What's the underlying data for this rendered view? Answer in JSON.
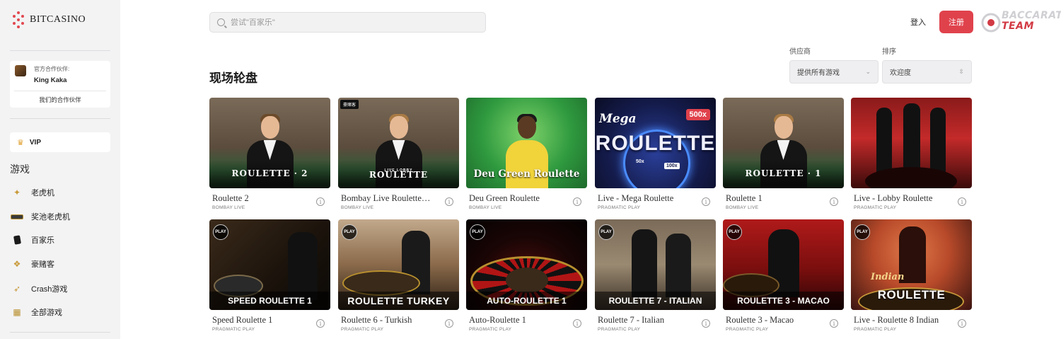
{
  "sidebar": {
    "logo_text": "BITCASINO",
    "partner": {
      "label": "官方合作伙伴:",
      "name": "King Kaka",
      "link": "我们的合作伙伴"
    },
    "vip_label": "VIP",
    "section_title": "游戏",
    "items": [
      {
        "label": "老虎机",
        "icon": "slot-machine-icon"
      },
      {
        "label": "奖池老虎机",
        "icon": "jackpot-icon"
      },
      {
        "label": "百家乐",
        "icon": "baccarat-card-icon"
      },
      {
        "label": "豪赌客",
        "icon": "high-roller-icon"
      },
      {
        "label": "Crash游戏",
        "icon": "rocket-icon"
      },
      {
        "label": "全部游戏",
        "icon": "grid-icon"
      }
    ]
  },
  "header": {
    "search_placeholder": "尝试\"百家乐\"",
    "login": "登入",
    "register": "注册",
    "brand_line1": "BACCARAT",
    "brand_line2": "TEAM"
  },
  "main": {
    "title": "现场轮盘",
    "provider_label": "供应商",
    "provider_value": "提供所有游戏",
    "sort_label": "排序",
    "sort_value": "欢迎度",
    "games": [
      {
        "title": "Roulette 2",
        "provider": "BOMBAY LIVE",
        "thumb_text": "ROULETTE · 2"
      },
      {
        "title": "Bombay Live Roulette…",
        "provider": "BOMBAY LIVE",
        "thumb_text": "ROULETTE",
        "tag": "豪赌客",
        "sub_text": "LIVE LOBBY"
      },
      {
        "title": "Deu Green Roulette",
        "provider": "BOMBAY LIVE",
        "thumb_text": "Deu Green Roulette"
      },
      {
        "title": "Live - Mega Roulette",
        "provider": "PRAGMATIC PLAY",
        "thumb_text": "ROULETTE",
        "thumb_script": "Mega",
        "multiplier": "500x",
        "chip1": "50x",
        "chip2": "100x"
      },
      {
        "title": "Roulette 1",
        "provider": "BOMBAY LIVE",
        "thumb_text": "ROULETTE · 1"
      },
      {
        "title": "Live - Lobby Roulette",
        "provider": "PRAGMATIC PLAY"
      },
      {
        "title": "Speed Roulette 1",
        "provider": "PRAGMATIC PLAY",
        "thumb_text": "SPEED ROULETTE 1"
      },
      {
        "title": "Roulette 6 - Turkish",
        "provider": "PRAGMATIC PLAY",
        "thumb_text": "ROULETTE TURKEY"
      },
      {
        "title": "Auto-Roulette 1",
        "provider": "PRAGMATIC PLAY",
        "thumb_text": "AUTO-ROULETTE 1"
      },
      {
        "title": "Roulette 7 - Italian",
        "provider": "PRAGMATIC PLAY",
        "thumb_text": "ROULETTE 7 - ITALIAN"
      },
      {
        "title": "Roulette 3 - Macao",
        "provider": "PRAGMATIC PLAY",
        "thumb_text": "ROULETTE 3 - MACAO"
      },
      {
        "title": "Live - Roulette 8 Indian",
        "provider": "PRAGMATIC PLAY",
        "thumb_text": "ROULETTE",
        "thumb_script": "Indian"
      }
    ],
    "play_badge": "PLAY",
    "info_glyph": "i"
  },
  "colors": {
    "accent": "#e0424c",
    "sidebar_bg": "#f3f3f4"
  }
}
